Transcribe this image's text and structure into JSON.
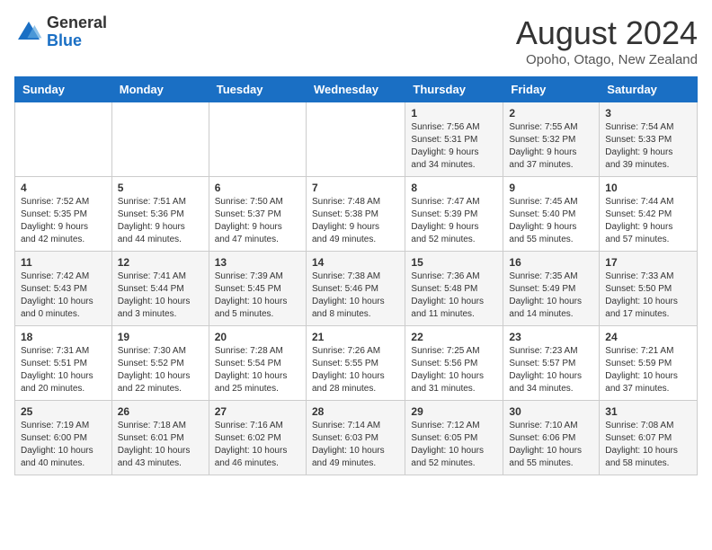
{
  "header": {
    "logo_general": "General",
    "logo_blue": "Blue",
    "month_title": "August 2024",
    "location": "Opoho, Otago, New Zealand"
  },
  "weekdays": [
    "Sunday",
    "Monday",
    "Tuesday",
    "Wednesday",
    "Thursday",
    "Friday",
    "Saturday"
  ],
  "weeks": [
    [
      {
        "day": "",
        "content": ""
      },
      {
        "day": "",
        "content": ""
      },
      {
        "day": "",
        "content": ""
      },
      {
        "day": "",
        "content": ""
      },
      {
        "day": "1",
        "content": "Sunrise: 7:56 AM\nSunset: 5:31 PM\nDaylight: 9 hours\nand 34 minutes."
      },
      {
        "day": "2",
        "content": "Sunrise: 7:55 AM\nSunset: 5:32 PM\nDaylight: 9 hours\nand 37 minutes."
      },
      {
        "day": "3",
        "content": "Sunrise: 7:54 AM\nSunset: 5:33 PM\nDaylight: 9 hours\nand 39 minutes."
      }
    ],
    [
      {
        "day": "4",
        "content": "Sunrise: 7:52 AM\nSunset: 5:35 PM\nDaylight: 9 hours\nand 42 minutes."
      },
      {
        "day": "5",
        "content": "Sunrise: 7:51 AM\nSunset: 5:36 PM\nDaylight: 9 hours\nand 44 minutes."
      },
      {
        "day": "6",
        "content": "Sunrise: 7:50 AM\nSunset: 5:37 PM\nDaylight: 9 hours\nand 47 minutes."
      },
      {
        "day": "7",
        "content": "Sunrise: 7:48 AM\nSunset: 5:38 PM\nDaylight: 9 hours\nand 49 minutes."
      },
      {
        "day": "8",
        "content": "Sunrise: 7:47 AM\nSunset: 5:39 PM\nDaylight: 9 hours\nand 52 minutes."
      },
      {
        "day": "9",
        "content": "Sunrise: 7:45 AM\nSunset: 5:40 PM\nDaylight: 9 hours\nand 55 minutes."
      },
      {
        "day": "10",
        "content": "Sunrise: 7:44 AM\nSunset: 5:42 PM\nDaylight: 9 hours\nand 57 minutes."
      }
    ],
    [
      {
        "day": "11",
        "content": "Sunrise: 7:42 AM\nSunset: 5:43 PM\nDaylight: 10 hours\nand 0 minutes."
      },
      {
        "day": "12",
        "content": "Sunrise: 7:41 AM\nSunset: 5:44 PM\nDaylight: 10 hours\nand 3 minutes."
      },
      {
        "day": "13",
        "content": "Sunrise: 7:39 AM\nSunset: 5:45 PM\nDaylight: 10 hours\nand 5 minutes."
      },
      {
        "day": "14",
        "content": "Sunrise: 7:38 AM\nSunset: 5:46 PM\nDaylight: 10 hours\nand 8 minutes."
      },
      {
        "day": "15",
        "content": "Sunrise: 7:36 AM\nSunset: 5:48 PM\nDaylight: 10 hours\nand 11 minutes."
      },
      {
        "day": "16",
        "content": "Sunrise: 7:35 AM\nSunset: 5:49 PM\nDaylight: 10 hours\nand 14 minutes."
      },
      {
        "day": "17",
        "content": "Sunrise: 7:33 AM\nSunset: 5:50 PM\nDaylight: 10 hours\nand 17 minutes."
      }
    ],
    [
      {
        "day": "18",
        "content": "Sunrise: 7:31 AM\nSunset: 5:51 PM\nDaylight: 10 hours\nand 20 minutes."
      },
      {
        "day": "19",
        "content": "Sunrise: 7:30 AM\nSunset: 5:52 PM\nDaylight: 10 hours\nand 22 minutes."
      },
      {
        "day": "20",
        "content": "Sunrise: 7:28 AM\nSunset: 5:54 PM\nDaylight: 10 hours\nand 25 minutes."
      },
      {
        "day": "21",
        "content": "Sunrise: 7:26 AM\nSunset: 5:55 PM\nDaylight: 10 hours\nand 28 minutes."
      },
      {
        "day": "22",
        "content": "Sunrise: 7:25 AM\nSunset: 5:56 PM\nDaylight: 10 hours\nand 31 minutes."
      },
      {
        "day": "23",
        "content": "Sunrise: 7:23 AM\nSunset: 5:57 PM\nDaylight: 10 hours\nand 34 minutes."
      },
      {
        "day": "24",
        "content": "Sunrise: 7:21 AM\nSunset: 5:59 PM\nDaylight: 10 hours\nand 37 minutes."
      }
    ],
    [
      {
        "day": "25",
        "content": "Sunrise: 7:19 AM\nSunset: 6:00 PM\nDaylight: 10 hours\nand 40 minutes."
      },
      {
        "day": "26",
        "content": "Sunrise: 7:18 AM\nSunset: 6:01 PM\nDaylight: 10 hours\nand 43 minutes."
      },
      {
        "day": "27",
        "content": "Sunrise: 7:16 AM\nSunset: 6:02 PM\nDaylight: 10 hours\nand 46 minutes."
      },
      {
        "day": "28",
        "content": "Sunrise: 7:14 AM\nSunset: 6:03 PM\nDaylight: 10 hours\nand 49 minutes."
      },
      {
        "day": "29",
        "content": "Sunrise: 7:12 AM\nSunset: 6:05 PM\nDaylight: 10 hours\nand 52 minutes."
      },
      {
        "day": "30",
        "content": "Sunrise: 7:10 AM\nSunset: 6:06 PM\nDaylight: 10 hours\nand 55 minutes."
      },
      {
        "day": "31",
        "content": "Sunrise: 7:08 AM\nSunset: 6:07 PM\nDaylight: 10 hours\nand 58 minutes."
      }
    ]
  ]
}
